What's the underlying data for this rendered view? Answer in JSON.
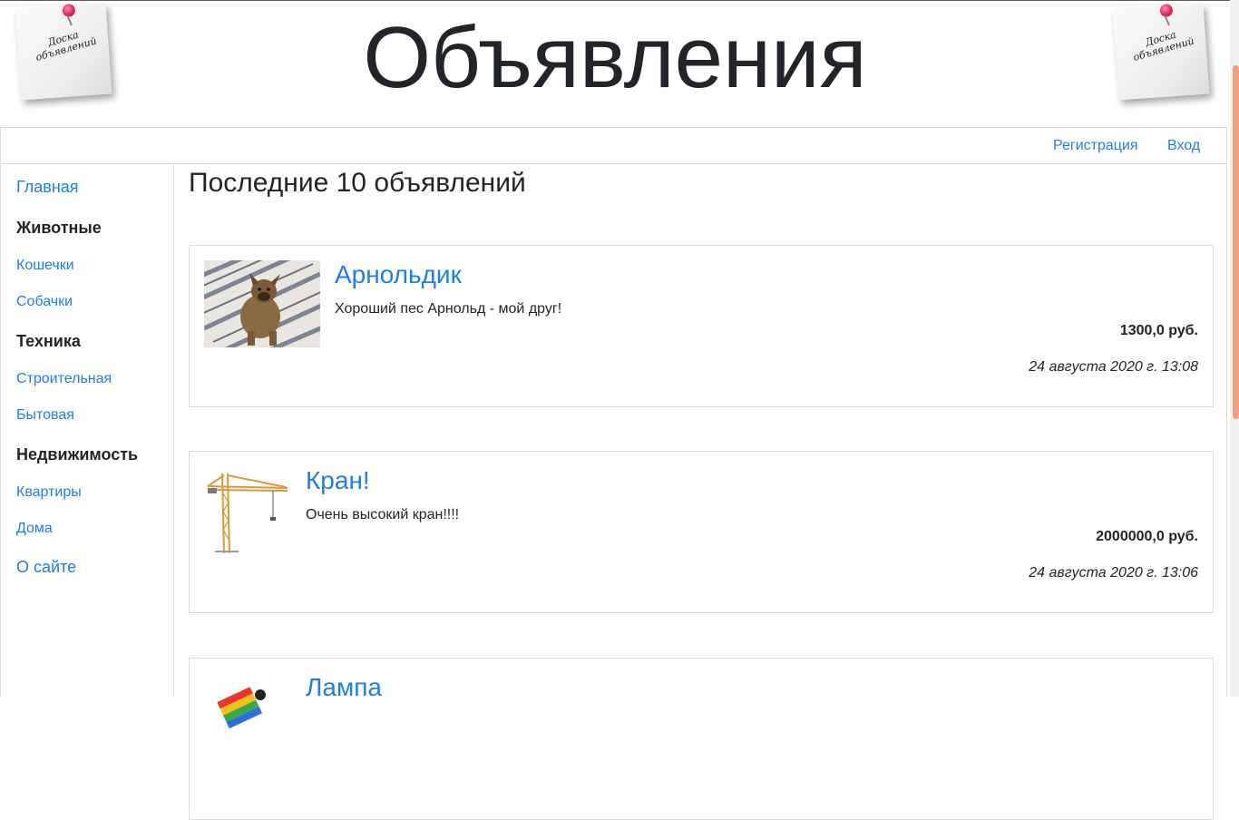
{
  "header": {
    "site_title": "Объявления",
    "logo_text_line1": "Доска",
    "logo_text_line2": "объявлений"
  },
  "nav": {
    "register": "Регистрация",
    "login": "Вход"
  },
  "sidebar": {
    "home": "Главная",
    "categories": [
      {
        "heading": "Животные",
        "items": [
          "Кошечки",
          "Собачки"
        ]
      },
      {
        "heading": "Техника",
        "items": [
          "Строительная",
          "Бытовая"
        ]
      },
      {
        "heading": "Недвижимость",
        "items": [
          "Квартиры",
          "Дома"
        ]
      }
    ],
    "about": "О сайте"
  },
  "main": {
    "heading": "Последние 10 объявлений",
    "listings": [
      {
        "title": "Арнольдик",
        "description": "Хороший пес Арнольд - мой друг!",
        "price": "1300,0 руб.",
        "date": "24 августа 2020 г. 13:08",
        "image": "dog-photo"
      },
      {
        "title": "Кран!",
        "description": "Очень высокий кран!!!!",
        "price": "2000000,0 руб.",
        "date": "24 августа 2020 г. 13:06",
        "image": "crane-photo"
      },
      {
        "title": "Лампа",
        "image": "lamp-photo"
      }
    ]
  },
  "colors": {
    "link": "#1d7fe6",
    "text": "#212529",
    "border": "#dcdcdc",
    "scroll_thumb": "#f0a080"
  }
}
